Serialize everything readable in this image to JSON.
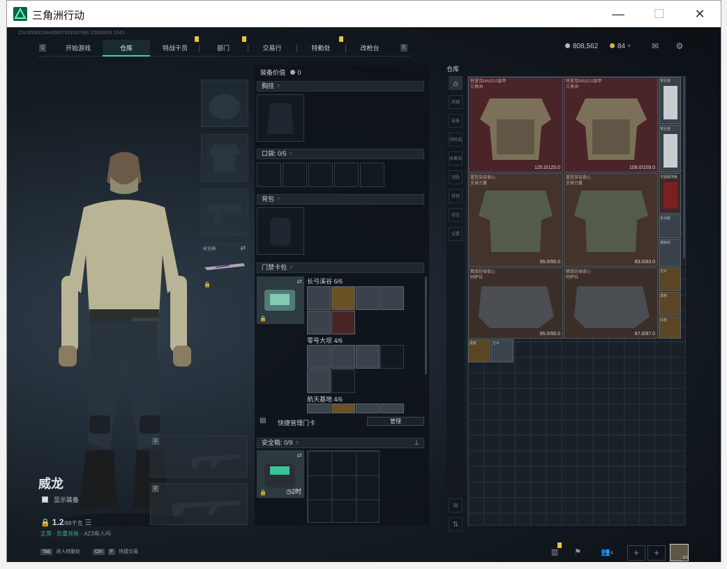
{
  "window": {
    "title": "三角洲行动",
    "minimize": "—",
    "maximize": "☐",
    "close": "✕"
  },
  "uid_line": "CN 00683154445607931007686 20260918 1543",
  "nav": {
    "left_key": "Q",
    "right_key": "E",
    "tabs": [
      {
        "label": "开始游戏",
        "active": false
      },
      {
        "label": "仓库",
        "active": true
      },
      {
        "label": "特战干员",
        "active": false
      },
      {
        "label": "部门",
        "active": false
      },
      {
        "label": "交易行",
        "active": false
      },
      {
        "label": "特勤处",
        "active": false
      },
      {
        "label": "改枪台",
        "active": false
      }
    ]
  },
  "currency": {
    "coins": "808,562",
    "bonds": "84",
    "add": "+"
  },
  "operator": {
    "name": "威龙",
    "show_equipment": "显示装备",
    "weight": "1.2",
    "weight_max": "/88千克",
    "status_green": "正常 · 负重充裕",
    "status_gray": "AZ3有人吗"
  },
  "hotkeys": [
    {
      "key": "Tab",
      "label": "进入特勤处"
    },
    {
      "key": "Ctrl",
      "key2": "F",
      "label": "快捷交易"
    }
  ],
  "equip_slots": {
    "gun_label": "安全箱",
    "weapon_slot_1": "1",
    "weapon_slot_2": "2"
  },
  "middle": {
    "equip_value_label": "装备价值",
    "equip_value": "0",
    "chest": "胸挂",
    "pocket": "口袋:",
    "pocket_val": "0/5",
    "backpack": "背包",
    "keycard": "门禁卡包",
    "key_groups": [
      {
        "name": "长弓溪谷",
        "count": "6/6"
      },
      {
        "name": "零号大坝",
        "count": "4/6"
      },
      {
        "name": "航天基地",
        "count": "4/6"
      }
    ],
    "quick_manage": "快捷管理门卡",
    "manage_btn": "管理",
    "safebox": "安全箱:",
    "safebox_val": "0/9",
    "safebox_time": "2时"
  },
  "storage": {
    "title": "仓库",
    "armors": [
      {
        "name": "特里克MAS2.0装甲",
        "sub": "三角洲",
        "dur": "125.0/125.0"
      },
      {
        "name": "特里克MAS2.0装甲",
        "sub": "三角洲",
        "dur": "109.0/109.0"
      },
      {
        "name": "重型突击背心",
        "sub": "全球力量",
        "dur": "95.0/95.0"
      },
      {
        "name": "重型突击背心",
        "sub": "全球力量",
        "dur": "83.0/83.0"
      },
      {
        "name": "精英防弹背心",
        "sub": "阿萨拉",
        "dur": "95.0/95.0"
      },
      {
        "name": "精英防弹背心",
        "sub": "阿萨拉",
        "dur": "87.0/87.0"
      }
    ],
    "side_items": [
      "铁合金",
      "铁合金",
      "天图服饰板",
      "多功能",
      "钢铁鸣",
      "方片",
      "黑桃",
      "红桃"
    ],
    "bottom_items": [
      "黑桃",
      "方片"
    ]
  },
  "sidebar_labels": [
    "全部",
    "武器",
    "装备",
    "消耗品",
    "收集品",
    "钥匙",
    "其他",
    "锁定",
    "设置"
  ],
  "footer": {
    "level": "60",
    "friends": "4"
  }
}
